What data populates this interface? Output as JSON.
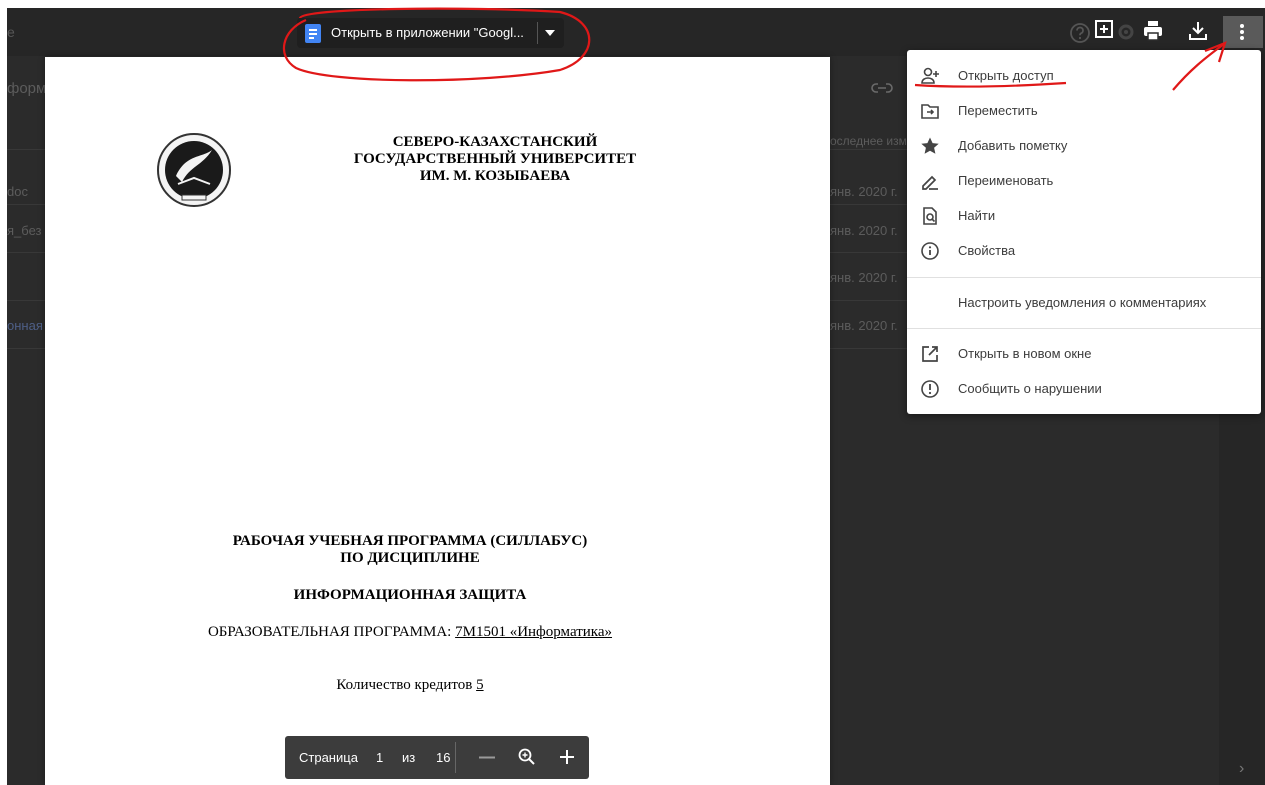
{
  "drive_background": {
    "title_fragment": "е",
    "name_fragments": [
      "форм",
      "doc",
      "я_без",
      "онная"
    ],
    "column_header": "оследнее изм",
    "dates": [
      "янв. 2020 г.",
      "янв. 2020 г.",
      "янв. 2020 г.",
      "янв. 2020 г."
    ]
  },
  "toolbar": {
    "open_in_app_label": "Открыть в приложении \"Googl...",
    "docs_icon": "google-docs-icon",
    "icons": [
      "help-icon",
      "add-to-drive-icon",
      "settings-icon",
      "print-icon",
      "download-icon",
      "more-vert-icon"
    ]
  },
  "document": {
    "university": [
      "СЕВЕРО-КАЗАХСТАНСКИЙ",
      "ГОСУДАРСТВЕННЫЙ УНИВЕРСИТЕТ",
      "ИМ. М. КОЗЫБАЕВА"
    ],
    "syllabus": [
      "РАБОЧАЯ УЧЕБНАЯ ПРОГРАММА (СИЛЛАБУС)",
      "ПО ДИСЦИПЛИНЕ"
    ],
    "discipline": "ИНФОРМАЦИОННАЯ ЗАЩИТА",
    "program_prefix": "ОБРАЗОВАТЕЛЬНАЯ ПРОГРАММА: ",
    "program_value": "7M1501 «Информатика»",
    "credits_prefix": "Количество кредитов ",
    "credits_value": "5"
  },
  "menu": {
    "items": [
      {
        "label": "Открыть доступ",
        "icon": "add-person-icon"
      },
      {
        "label": "Переместить",
        "icon": "move-to-folder-icon"
      },
      {
        "label": "Добавить пометку",
        "icon": "star-icon"
      },
      {
        "label": "Переименовать",
        "icon": "rename-pencil-icon"
      },
      {
        "label": "Найти",
        "icon": "find-in-page-icon"
      },
      {
        "label": "Свойства",
        "icon": "info-icon"
      },
      {
        "label": "Настроить уведомления о комментариях",
        "icon": ""
      },
      {
        "label": "Открыть в новом окне",
        "icon": "open-in-new-icon"
      },
      {
        "label": "Сообщить о нарушении",
        "icon": "report-icon"
      }
    ]
  },
  "pager": {
    "page_label": "Страница",
    "current_page": "1",
    "of_label": "из",
    "total_pages": "16"
  },
  "colors": {
    "annotation_red": "#e01818",
    "docs_blue": "#4285f4",
    "menu_text": "#3c3c3c"
  }
}
